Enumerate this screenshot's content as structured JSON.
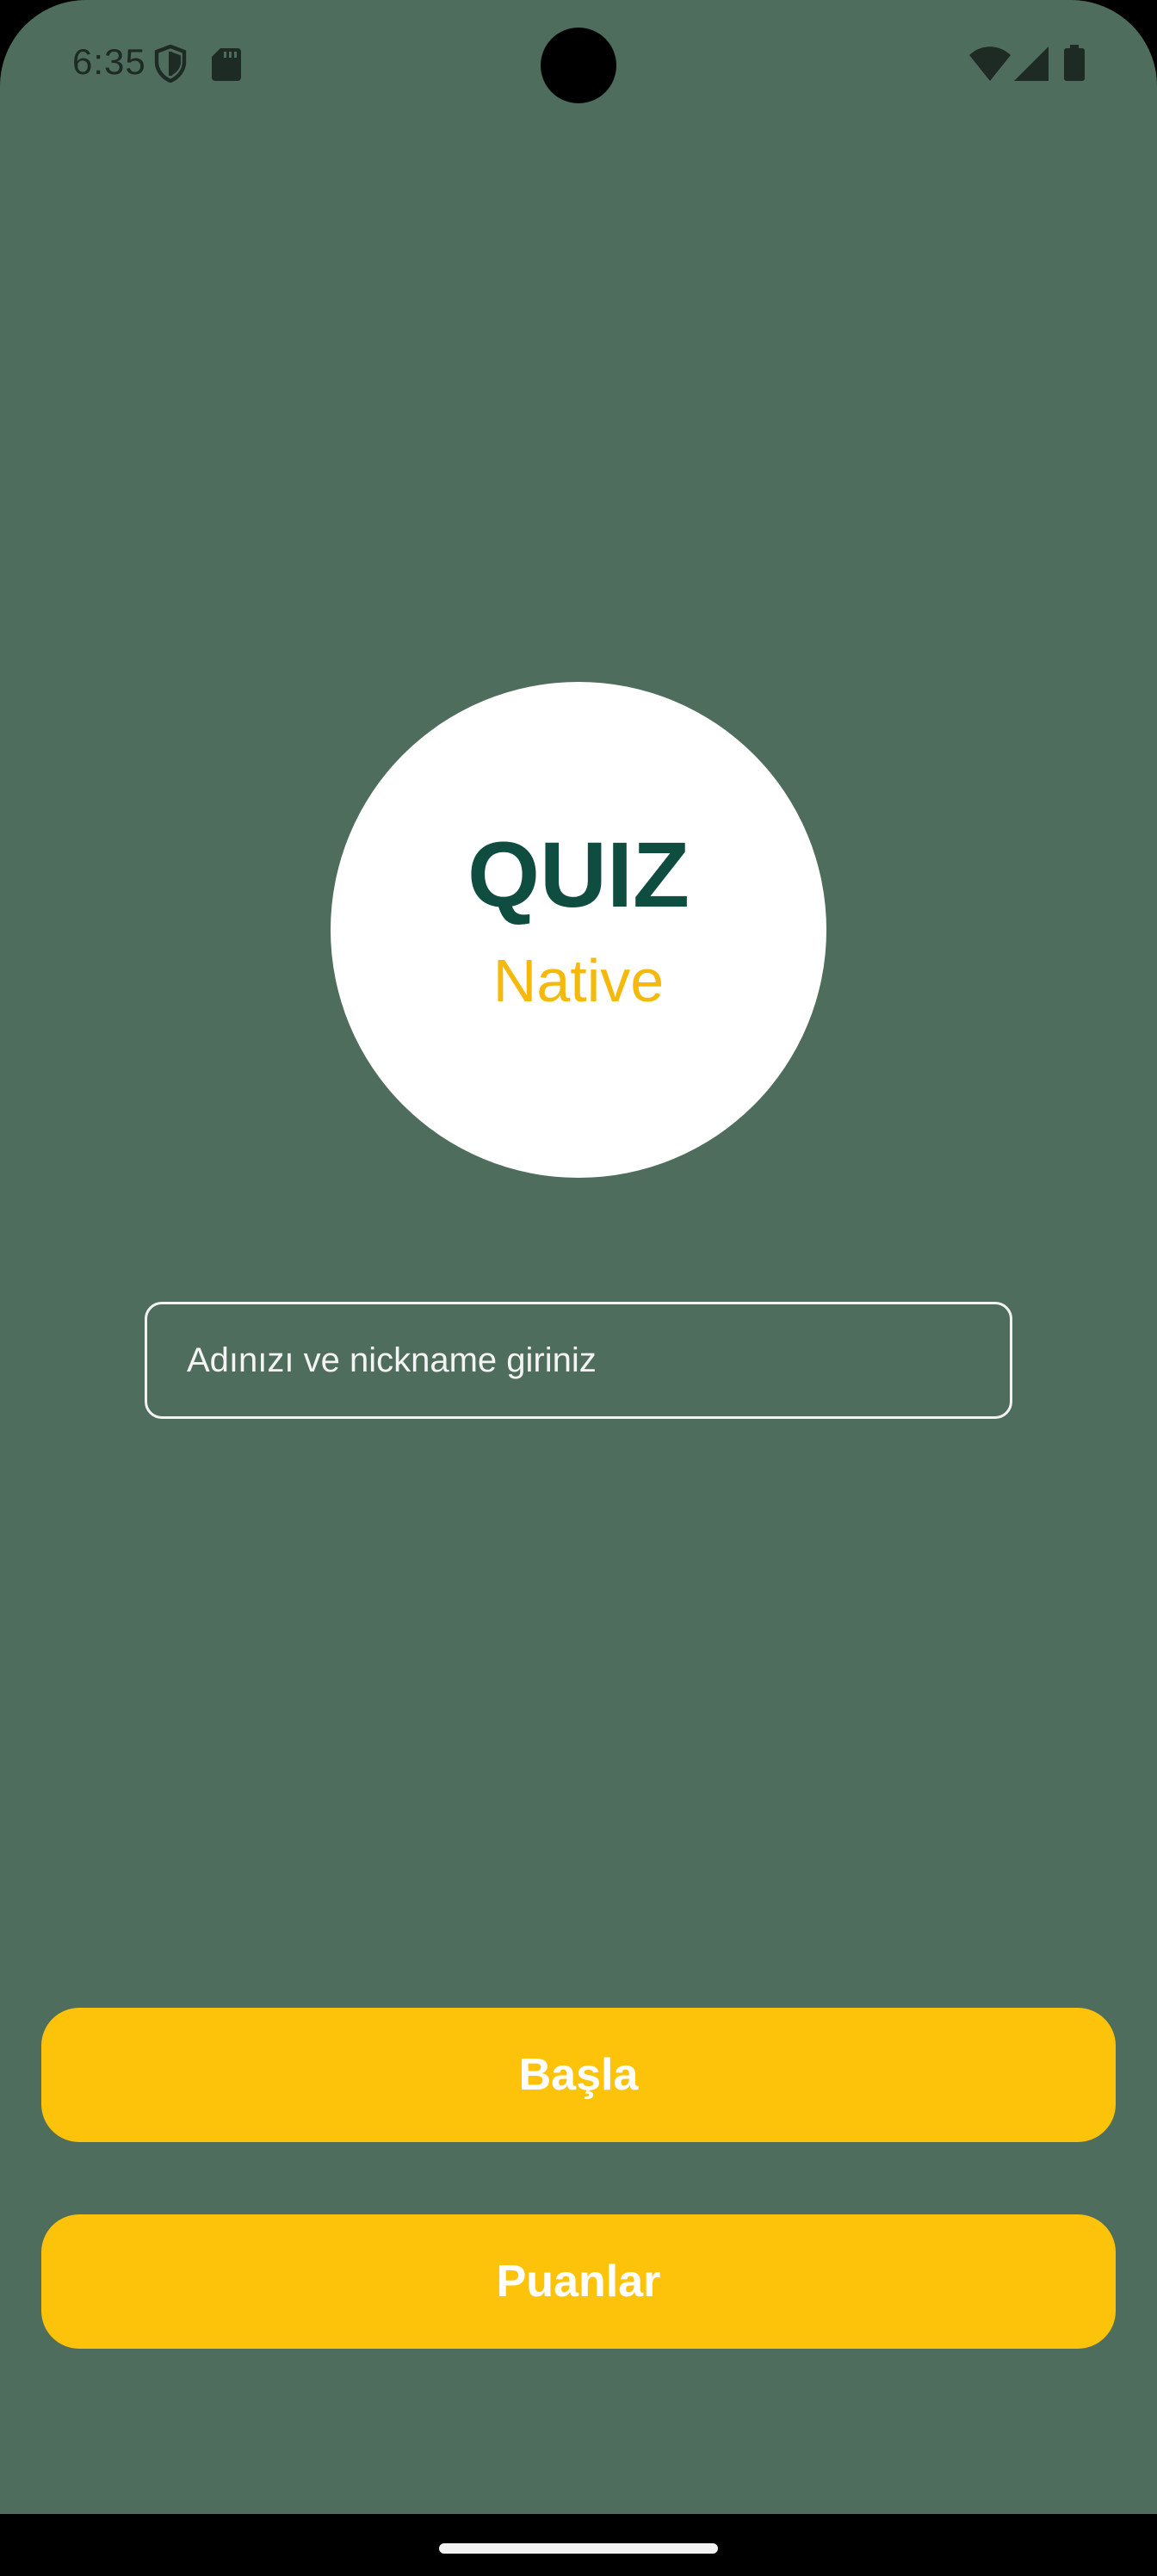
{
  "status_bar": {
    "time": "6:35",
    "icons": [
      "shield-icon",
      "sd-card-icon",
      "wifi-icon",
      "cell-signal-icon",
      "battery-icon"
    ]
  },
  "logo": {
    "title": "QUIZ",
    "subtitle": "Native"
  },
  "name_input": {
    "placeholder": "Adınızı ve nickname giriniz",
    "value": ""
  },
  "buttons": {
    "start_label": "Başla",
    "scores_label": "Puanlar"
  },
  "colors": {
    "background": "#4F6D5D",
    "accent": "#FDC20A",
    "logo_title": "#0E4D3F",
    "logo_subtitle": "#F5B90C"
  }
}
